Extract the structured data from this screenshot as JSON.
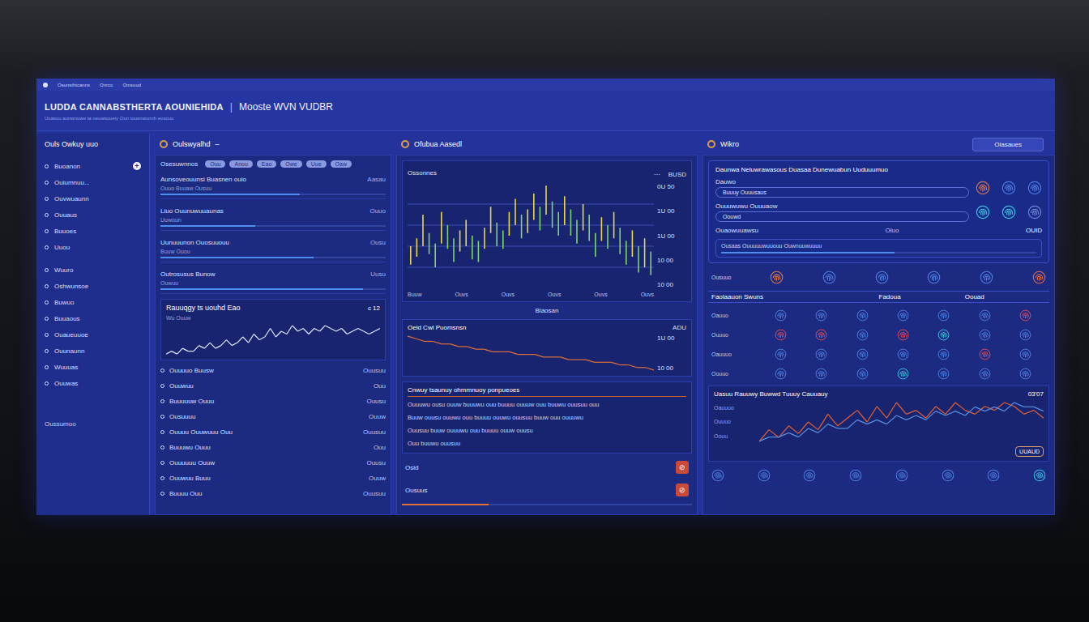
{
  "topbar": {
    "items": [
      "Osunsthtcanns",
      "Onrco",
      "Omsoud"
    ]
  },
  "header": {
    "title": "LUDDA CANNABSTHERTA AOUNIEHIDA",
    "divider": "|",
    "subtitle": "Mooste WVN VUDBR",
    "caption": "Uuasou aunwnowe ta neuwsoueiy Oun tousnwunnh eoscuu"
  },
  "sidebar": {
    "title": "Ouls Owkuy uuo",
    "add": "+",
    "groups": [
      [
        {
          "label": "Buoanon",
          "selected": false
        },
        {
          "label": "Ouiumnuu...",
          "selected": false
        },
        {
          "label": "Ouvwuaunn",
          "selected": false
        },
        {
          "label": "Ouuaus",
          "selected": false
        },
        {
          "label": "Buuoes",
          "selected": false
        },
        {
          "label": "Uuou",
          "selected": false
        }
      ],
      [
        {
          "label": "Wuuro",
          "selected": false
        },
        {
          "label": "Oshwunsoe",
          "selected": false
        },
        {
          "label": "Buwuo",
          "selected": false
        },
        {
          "label": "Buuaous",
          "selected": false
        },
        {
          "label": "Ouaueuuoe",
          "selected": false
        },
        {
          "label": "Ouunaunn",
          "selected": false
        },
        {
          "label": "Wuuuas",
          "selected": false
        },
        {
          "label": "Ouuwas",
          "selected": false
        }
      ]
    ],
    "footer": "Oussumoo"
  },
  "overview": {
    "title": "Oulswyalhd",
    "mark": "–",
    "tag_label": "Osesuwnnos",
    "tags": [
      "Ouu",
      "Anou",
      "Eao",
      "Owe",
      "Uue",
      "Oaw"
    ],
    "metrics": [
      {
        "label": "Aunsoveouunsi Buasnen ouio",
        "note": "Ouuo Buuaw Ousuu",
        "value": "Aasau",
        "level": 0.62
      },
      {
        "label": "Liuo Ouunuwuuaunas",
        "note": "Uuwoun",
        "value": "Ouuo",
        "level": 0.42
      },
      {
        "label": "Uunuuunon Ouosuuouu",
        "note": "Buuw Ouou",
        "value": "Ousu",
        "level": 0.68
      },
      {
        "label": "Outrosusus Bunow",
        "note": "Ouwuu",
        "value": "Uusu",
        "level": 0.9
      }
    ],
    "trend": {
      "title": "Rauuqgy ts uouhd Eao",
      "badge": "c 12",
      "label": "Wu Ouuw",
      "values": [
        3,
        4,
        3,
        5,
        4,
        4,
        6,
        5,
        7,
        5,
        6,
        8,
        6,
        7,
        9,
        7,
        10,
        8,
        9,
        12,
        9,
        11,
        10,
        13,
        11,
        12,
        10,
        12,
        11,
        13,
        12,
        11,
        12,
        10,
        11,
        12,
        11,
        10,
        11,
        12
      ]
    },
    "list": [
      {
        "label": "Ouuuuo Buusw",
        "value": "Ouusuu"
      },
      {
        "label": "Ouuwuu",
        "value": "Ouu"
      },
      {
        "label": "Buuuuuw Ouuu",
        "value": "Ouusu"
      },
      {
        "label": "Ousuuuu",
        "value": "Ouuw"
      },
      {
        "label": "Ouuuu Ouuwuuu Ouu",
        "value": "Ouusuu"
      },
      {
        "label": "Buuuwu Ouuu",
        "value": "Ouu"
      },
      {
        "label": "Ouuuuuu Ouuw",
        "value": "Ouusu"
      },
      {
        "label": "Ouuwuu Buuu",
        "value": "Ouuw"
      },
      {
        "label": "Buuuu Ouu",
        "value": "Ouusuu"
      }
    ]
  },
  "market": {
    "title": "Ofubua Aasedl",
    "chart": {
      "label": "Ossonnes",
      "controls": [
        "⋯",
        "BUSD"
      ],
      "ticks": [
        "0U 50",
        "1U 00",
        "1U 00",
        "10 00",
        "10 00"
      ],
      "x_labels": [
        "Buuw",
        "Ouvs",
        "Ouvs",
        "Ouvs",
        "Ouvs",
        "Ouvs"
      ],
      "high": [
        11.6,
        11.9,
        12.8,
        12.1,
        11.7,
        12.9,
        12.4,
        11.9,
        12.2,
        12.6,
        12.0,
        11.8,
        12.3,
        13.1,
        12.5,
        12.2,
        12.9,
        13.4,
        12.8,
        13.0,
        13.6,
        13.1,
        13.9,
        13.3,
        12.9,
        13.5,
        13.0,
        12.6,
        13.2,
        12.8,
        12.1,
        12.7,
        12.4,
        12.9,
        12.3,
        11.8,
        12.2,
        11.6,
        11.9,
        11.4
      ],
      "low": [
        10.9,
        11.2,
        11.6,
        11.3,
        10.8,
        11.7,
        11.5,
        11.0,
        11.4,
        11.6,
        11.1,
        11.0,
        11.5,
        12.1,
        11.6,
        11.5,
        12.0,
        12.4,
        11.9,
        12.1,
        12.6,
        12.2,
        12.8,
        12.3,
        12.0,
        12.4,
        12.0,
        11.7,
        12.2,
        11.8,
        11.2,
        11.8,
        11.5,
        11.9,
        11.3,
        10.9,
        11.2,
        10.6,
        10.8,
        10.5
      ]
    },
    "caption": "Blaosan",
    "sub_chart": {
      "title": "Oeld Cwl Puomsnsn",
      "value": "ADU",
      "ticks": [
        "1U 00",
        "10 00"
      ],
      "values": [
        4.2,
        4.1,
        4.0,
        4.0,
        3.9,
        3.9,
        3.8,
        3.8,
        3.7,
        3.7,
        3.6,
        3.6,
        3.6,
        3.5,
        3.5,
        3.5,
        3.4,
        3.4,
        3.4,
        3.3,
        3.3,
        3.3,
        3.2,
        3.2,
        3.2,
        3.1,
        3.1,
        3.0,
        3.0,
        2.9
      ]
    },
    "notes": {
      "title": "Cnwuy tsaunuy ohmmnuoy ponpueoes",
      "lines": [
        "Ouuuwu ousu ouuw buuuwu ouu buuuu ouuuw ouu buuwu ouusuu ouu",
        "Buuw ouusu ouuwu ouu buuuu ouuwu ouusuu buuw ouu ouuuwu",
        "Ouusuu buuw ouuuwu ouu buuuu ouuw ouusu",
        "Ouu buuwu ouusuu"
      ]
    },
    "actions": [
      {
        "label": "Osid",
        "badge": "⊘"
      },
      {
        "label": "Ousuus",
        "badge": "⊘"
      }
    ],
    "meter": {
      "level": 0.3
    }
  },
  "watch": {
    "title": "Wikro",
    "button": "Olasaues",
    "heading": "Daunwa Neluwrawasous Duasaa Dunewuabun Uuduuumuo",
    "alerts": [
      {
        "label": "Dauwo",
        "sub": "Buuuy Ouuusaus",
        "markers": [
          {
            "color": "#d9774f"
          },
          {
            "color": "#4f7fe0"
          },
          {
            "color": "#4f7fe0"
          }
        ]
      },
      {
        "label": "Ouuuwuwu Ouuuaow",
        "sub": "Oouwd",
        "markers": [
          {
            "color": "#3fc3e0"
          },
          {
            "color": "#3fc3e0"
          },
          {
            "color": "#6f86d8"
          }
        ]
      }
    ],
    "status": {
      "label": "Ouaowuuawsu",
      "value": "Oluo",
      "right": "OUID"
    },
    "bar": {
      "label": "Ousaas Ouuuuuwuuouu Ouwnuuwuuuu",
      "level": 0.55
    },
    "prints_label": "Ousuuo",
    "prints": [
      {
        "color": "#d9774f"
      },
      {
        "color": "#4f7fe0"
      },
      {
        "color": "#4f7fe0"
      },
      {
        "color": "#4f7fe0"
      },
      {
        "color": "#4f7fe0"
      },
      {
        "color": "#e06a4a"
      }
    ],
    "table": {
      "columns": [
        "Faolaauon Swuns",
        "Fadoua",
        "Oouad"
      ],
      "rows": [
        {
          "label": "Oauuo",
          "cells": [
            {
              "color": "#4f7fe0"
            },
            {
              "color": "#4f7fe0"
            },
            {
              "color": "#4f7fe0"
            },
            {
              "color": "#4f7fe0"
            },
            {
              "color": "#4f7fe0"
            },
            {
              "color": "#4f7fe0"
            },
            {
              "color": "#e0485a"
            }
          ]
        },
        {
          "label": "Ouuuo",
          "cells": [
            {
              "color": "#e0485a"
            },
            {
              "color": "#e0485a"
            },
            {
              "color": "#4f7fe0"
            },
            {
              "color": "#e0485a"
            },
            {
              "color": "#3fc3e0"
            },
            {
              "color": "#4f7fe0"
            },
            {
              "color": "#4f7fe0"
            }
          ]
        },
        {
          "label": "Oauuuo",
          "cells": [
            {
              "color": "#4f7fe0"
            },
            {
              "color": "#4f7fe0"
            },
            {
              "color": "#4f7fe0"
            },
            {
              "color": "#4f7fe0"
            },
            {
              "color": "#4f7fe0"
            },
            {
              "color": "#e0485a"
            },
            {
              "color": "#4f7fe0"
            }
          ]
        },
        {
          "label": "Oouuo",
          "cells": [
            {
              "color": "#4f7fe0"
            },
            {
              "color": "#4f7fe0"
            },
            {
              "color": "#4f7fe0"
            },
            {
              "color": "#3fc3e0"
            },
            {
              "color": "#4f7fe0"
            },
            {
              "color": "#4f7fe0"
            },
            {
              "color": "#4f7fe0"
            }
          ]
        }
      ]
    },
    "scan": {
      "title": "Uasuu Rauuwy Buwwd Tuuuy Cauuauy",
      "value": "03'07",
      "badge": "UUAUD",
      "labels": [
        "Oauuuo",
        "Ouuuo",
        "Oouu"
      ],
      "series": [
        {
          "color": "#e0603a",
          "values": [
            2,
            5,
            3,
            6,
            4,
            7,
            5,
            9,
            6,
            8,
            10,
            7,
            11,
            8,
            12,
            9,
            10,
            8,
            11,
            9,
            12,
            10,
            9,
            11,
            10,
            12,
            11,
            9,
            10,
            8
          ]
        },
        {
          "color": "#5a8fe0",
          "values": [
            1,
            2,
            2,
            3,
            2,
            4,
            3,
            5,
            4,
            4,
            6,
            5,
            6,
            5,
            7,
            6,
            7,
            6,
            8,
            7,
            8,
            7,
            9,
            8,
            9,
            8,
            10,
            9,
            9,
            8
          ]
        }
      ]
    },
    "footer_prints": [
      {
        "color": "#4f7fe0"
      },
      {
        "color": "#4f7fe0"
      },
      {
        "color": "#4f7fe0"
      },
      {
        "color": "#4f7fe0"
      },
      {
        "color": "#4f7fe0"
      },
      {
        "color": "#4f7fe0"
      },
      {
        "color": "#4f7fe0"
      },
      {
        "color": "#3fc3e0"
      }
    ]
  }
}
